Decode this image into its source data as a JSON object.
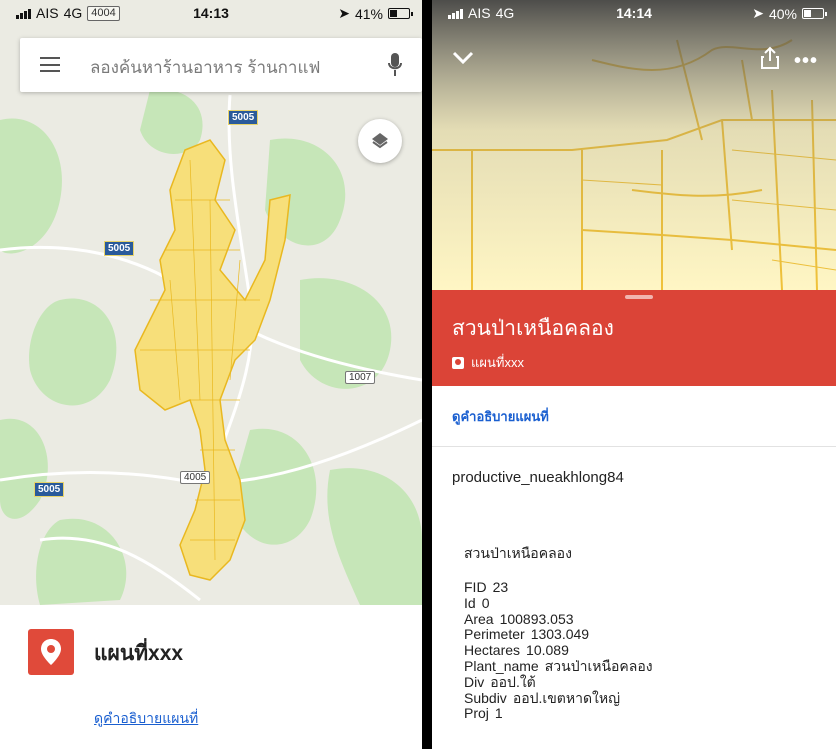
{
  "left": {
    "status": {
      "carrier": "AIS",
      "network": "4G",
      "route_badge": "4004",
      "time": "14:13",
      "battery_text": "41%",
      "battery_level": 0.41
    },
    "search": {
      "placeholder": "ลองค้นหาร้านอาหาร ร้านกาแฟ"
    },
    "map": {
      "road_labels": [
        "5005",
        "5005",
        "1007",
        "4005",
        "5005"
      ],
      "polygon_color": "#f2c63a",
      "icons": [
        "hamburger-icon",
        "mic-icon",
        "layers-icon"
      ]
    },
    "sheet": {
      "title": "แผนที่xxx",
      "link": "ดูคำอธิบายแผนที่",
      "icon": "map-pin-icon",
      "accent": "#e04a3a"
    }
  },
  "right": {
    "status": {
      "carrier": "AIS",
      "network": "4G",
      "time": "14:14",
      "battery_text": "40%",
      "battery_level": 0.4
    },
    "header": {
      "title": "สวนป่าเหนือคลอง",
      "map_name": "แผนที่xxx",
      "color": "#db4437"
    },
    "description_link": "ดูคำอธิบายแผนที่",
    "layer_name": "productive_nueakhlong84",
    "detail_name": "สวนป่าเหนือคลอง",
    "attributes": [
      {
        "key": "FID",
        "value": "23"
      },
      {
        "key": "Id",
        "value": "0"
      },
      {
        "key": "Area",
        "value": "100893.053"
      },
      {
        "key": "Perimeter",
        "value": "1303.049"
      },
      {
        "key": "Hectares",
        "value": "10.089"
      },
      {
        "key": "Plant_name",
        "value": "สวนป่าเหนือคลอง"
      },
      {
        "key": "Div",
        "value": "ออป.ใต้"
      },
      {
        "key": "Subdiv",
        "value": "ออป.เขตหาดใหญ่"
      },
      {
        "key": "Proj",
        "value": "1"
      }
    ]
  }
}
